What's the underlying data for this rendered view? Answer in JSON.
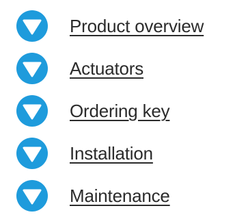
{
  "colors": {
    "icon_fill": "#1e9bdc",
    "icon_arrow": "#ffffff",
    "link_text": "#2b2b2b"
  },
  "nav": {
    "items": [
      {
        "label": "Product overview",
        "icon": "chevron-down-circle-icon"
      },
      {
        "label": "Actuators",
        "icon": "chevron-down-circle-icon"
      },
      {
        "label": "Ordering key",
        "icon": "chevron-down-circle-icon"
      },
      {
        "label": "Installation",
        "icon": "chevron-down-circle-icon"
      },
      {
        "label": "Maintenance",
        "icon": "chevron-down-circle-icon"
      }
    ]
  }
}
